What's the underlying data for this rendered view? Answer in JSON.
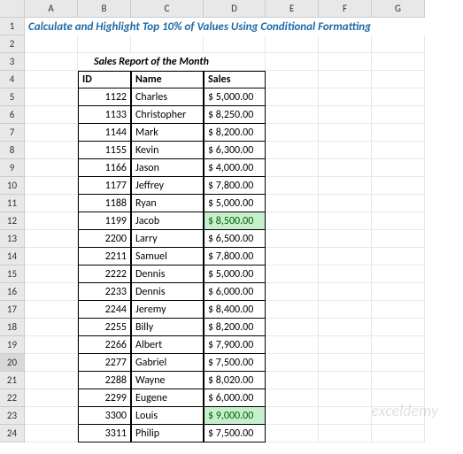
{
  "columns": [
    "A",
    "B",
    "C",
    "D",
    "E",
    "F",
    "G"
  ],
  "row_numbers": [
    1,
    2,
    3,
    4,
    5,
    6,
    7,
    8,
    9,
    10,
    11,
    12,
    13,
    14,
    15,
    16,
    17,
    18,
    19,
    20,
    21,
    22,
    23,
    24
  ],
  "selected_row": 20,
  "title": "Calculate and Highlight Top 10% of Values Using Conditional Formatting",
  "subtitle": "Sales Report of the Month",
  "headers": {
    "id": "ID",
    "name": "Name",
    "sales": "Sales"
  },
  "rows": [
    {
      "id": "1122",
      "name": "Charles",
      "sales": "$  5,000.00",
      "hl": false
    },
    {
      "id": "1133",
      "name": "Christopher",
      "sales": "$  8,250.00",
      "hl": false
    },
    {
      "id": "1144",
      "name": "Mark",
      "sales": "$  8,200.00",
      "hl": false
    },
    {
      "id": "1155",
      "name": "Kevin",
      "sales": "$  6,300.00",
      "hl": false
    },
    {
      "id": "1166",
      "name": "Jason",
      "sales": "$  4,000.00",
      "hl": false
    },
    {
      "id": "1177",
      "name": "Jeffrey",
      "sales": "$  7,800.00",
      "hl": false
    },
    {
      "id": "1188",
      "name": "Ryan",
      "sales": "$  5,000.00",
      "hl": false
    },
    {
      "id": "1199",
      "name": "Jacob",
      "sales": "$  8,500.00",
      "hl": true
    },
    {
      "id": "2200",
      "name": "Larry",
      "sales": "$  6,500.00",
      "hl": false
    },
    {
      "id": "2211",
      "name": "Samuel",
      "sales": "$  7,800.00",
      "hl": false
    },
    {
      "id": "2222",
      "name": "Dennis",
      "sales": "$  5,000.00",
      "hl": false
    },
    {
      "id": "2233",
      "name": "Dennis",
      "sales": "$  6,000.00",
      "hl": false
    },
    {
      "id": "2244",
      "name": "Jeremy",
      "sales": "$  8,400.00",
      "hl": false
    },
    {
      "id": "2255",
      "name": "Billy",
      "sales": "$  8,200.00",
      "hl": false
    },
    {
      "id": "2266",
      "name": "Albert",
      "sales": "$  7,900.00",
      "hl": false
    },
    {
      "id": "2277",
      "name": "Gabriel",
      "sales": "$  7,500.00",
      "hl": false
    },
    {
      "id": "2288",
      "name": "Wayne",
      "sales": "$  8,020.00",
      "hl": false
    },
    {
      "id": "2299",
      "name": "Eugene",
      "sales": "$  6,000.00",
      "hl": false
    },
    {
      "id": "3300",
      "name": "Louis",
      "sales": "$  9,000.00",
      "hl": true
    },
    {
      "id": "3311",
      "name": "Philip",
      "sales": "$  7,500.00",
      "hl": false
    }
  ],
  "watermark": "exceldemy"
}
